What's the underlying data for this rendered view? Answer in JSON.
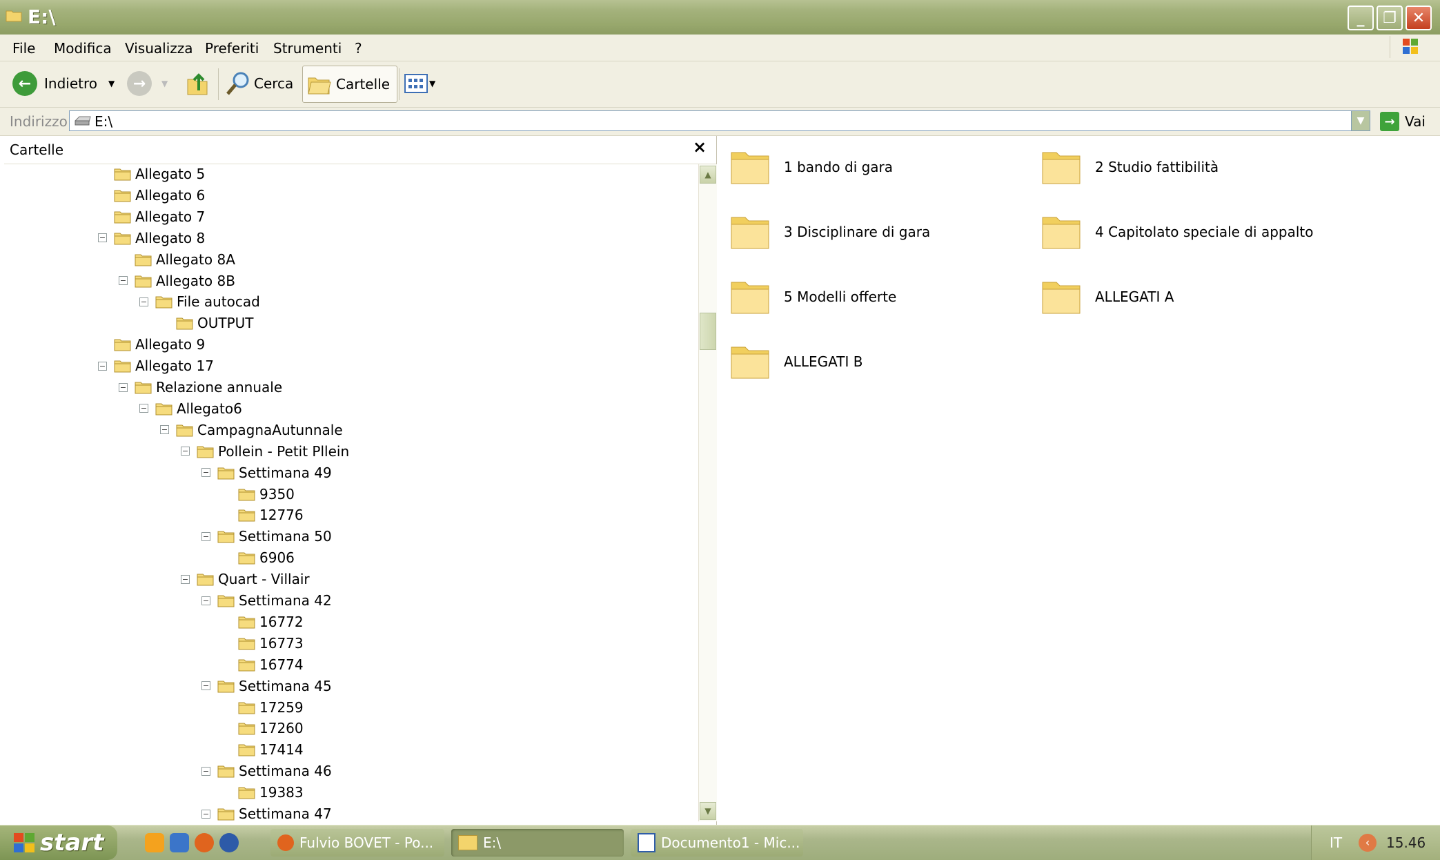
{
  "window": {
    "title": "E:\\"
  },
  "menu": [
    "File",
    "Modifica",
    "Visualizza",
    "Preferiti",
    "Strumenti",
    "?"
  ],
  "toolbar": {
    "back_label": "Indietro",
    "search_label": "Cerca",
    "folders_label": "Cartelle"
  },
  "address": {
    "label": "Indirizzo",
    "value": "E:\\",
    "go_label": "Vai"
  },
  "folders_pane": {
    "title": "Cartelle",
    "close_glyph": "×"
  },
  "tree": [
    {
      "label": "Allegato 5",
      "expander": ""
    },
    {
      "label": "Allegato 6",
      "expander": ""
    },
    {
      "label": "Allegato 7",
      "expander": ""
    },
    {
      "label": "Allegato 8",
      "expander": "−"
    },
    {
      "label": "Allegato 8A",
      "expander": ""
    },
    {
      "label": "Allegato 8B",
      "expander": "−"
    },
    {
      "label": "File autocad",
      "expander": "−"
    },
    {
      "label": "OUTPUT",
      "expander": ""
    },
    {
      "label": "Allegato 9",
      "expander": ""
    },
    {
      "label": "Allegato 17",
      "expander": "−"
    },
    {
      "label": "Relazione annuale",
      "expander": "−"
    },
    {
      "label": "Allegato6",
      "expander": "−"
    },
    {
      "label": "CampagnaAutunnale",
      "expander": "−"
    },
    {
      "label": "Pollein - Petit Pllein",
      "expander": "−"
    },
    {
      "label": "Settimana 49",
      "expander": "−"
    },
    {
      "label": "9350",
      "expander": ""
    },
    {
      "label": "12776",
      "expander": ""
    },
    {
      "label": "Settimana 50",
      "expander": "−"
    },
    {
      "label": "6906",
      "expander": ""
    },
    {
      "label": "Quart - Villair",
      "expander": "−"
    },
    {
      "label": "Settimana 42",
      "expander": "−"
    },
    {
      "label": "16772",
      "expander": ""
    },
    {
      "label": "16773",
      "expander": ""
    },
    {
      "label": "16774",
      "expander": ""
    },
    {
      "label": "Settimana 45",
      "expander": "−"
    },
    {
      "label": "17259",
      "expander": ""
    },
    {
      "label": "17260",
      "expander": ""
    },
    {
      "label": "17414",
      "expander": ""
    },
    {
      "label": "Settimana 46",
      "expander": "−"
    },
    {
      "label": "19383",
      "expander": ""
    },
    {
      "label": "Settimana 47",
      "expander": "−"
    }
  ],
  "content_items": [
    "1 bando di gara",
    "2 Studio fattibilità",
    "3 Disciplinare di gara",
    "4 Capitolato speciale di appalto",
    "5 Modelli offerte",
    "ALLEGATI A",
    "ALLEGATI B"
  ],
  "taskbar": {
    "start_label": "start",
    "tasks": [
      "Fulvio BOVET - Po...",
      "E:\\",
      "Documento1 - Mic..."
    ],
    "language": "IT",
    "clock": "15.46"
  },
  "colors": {
    "folder": "#f3d46c",
    "accent_green": "#7d9554"
  }
}
